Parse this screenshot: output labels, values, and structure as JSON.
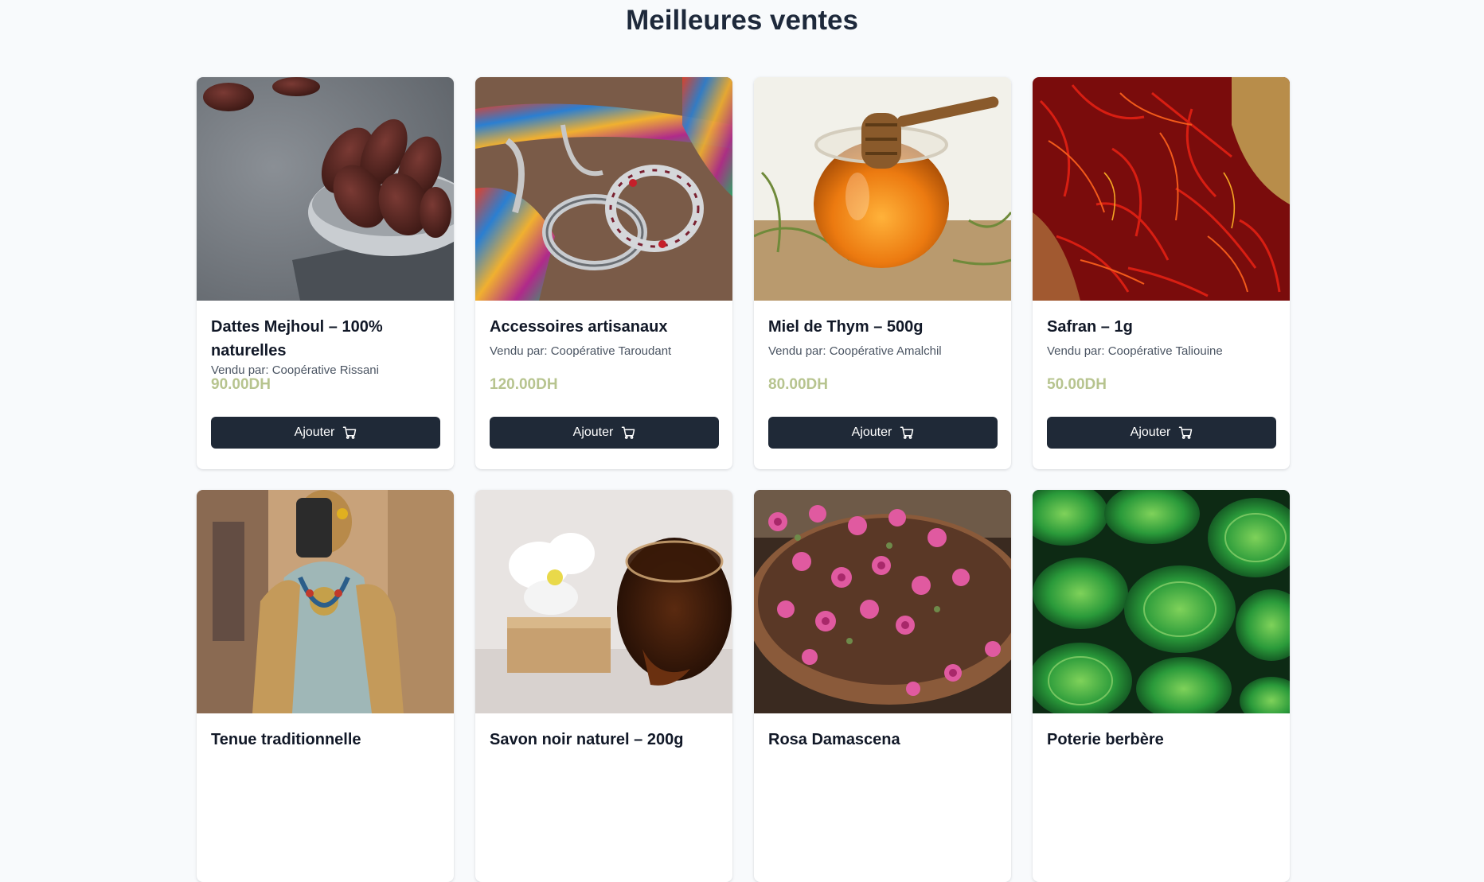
{
  "page": {
    "section_title": "Meilleures ventes"
  },
  "colors": {
    "background": "#f8fafc",
    "button_bg": "#1f2937",
    "price": "#b7c48f",
    "title": "#111827",
    "seller": "#4b5563"
  },
  "products": [
    {
      "title": "Dattes Mejhoul – 100% naturelles",
      "seller": "Vendu par: Coopérative Rissani",
      "price": "90.00DH",
      "button_label": "Ajouter",
      "image_icon": "dates-photo"
    },
    {
      "title": "Accessoires artisanaux",
      "seller": "Vendu par: Coopérative Taroudant",
      "price": "120.00DH",
      "button_label": "Ajouter",
      "image_icon": "bracelets-photo"
    },
    {
      "title": "Miel de Thym – 500g",
      "seller": "Vendu par: Coopérative Amalchil",
      "price": "80.00DH",
      "button_label": "Ajouter",
      "image_icon": "honey-jar-photo"
    },
    {
      "title": "Safran – 1g",
      "seller": "Vendu par: Coopérative Taliouine",
      "price": "50.00DH",
      "button_label": "Ajouter",
      "image_icon": "saffron-photo"
    },
    {
      "title": "Tenue traditionnelle",
      "image_icon": "traditional-outfit-photo"
    },
    {
      "title": "Savon noir naturel – 200g",
      "image_icon": "black-soap-photo"
    },
    {
      "title": "Rosa Damascena",
      "image_icon": "dried-roses-photo"
    },
    {
      "title": "Poterie berbère",
      "image_icon": "green-pottery-photo"
    }
  ]
}
